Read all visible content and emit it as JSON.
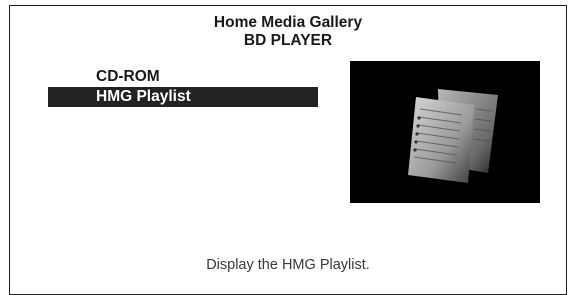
{
  "header": {
    "title": "Home Media Gallery",
    "subtitle": "BD PLAYER"
  },
  "menu": {
    "items": [
      {
        "label": "CD-ROM",
        "selected": false
      },
      {
        "label": "HMG Playlist",
        "selected": true
      }
    ]
  },
  "preview": {
    "icon": "playlist-documents-icon"
  },
  "status": {
    "text": "Display the HMG Playlist."
  }
}
